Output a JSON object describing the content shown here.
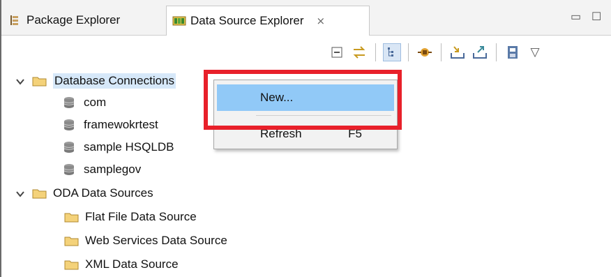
{
  "tabs": [
    {
      "label": "Package Explorer",
      "icon": "package-explorer-icon"
    },
    {
      "label": "Data Source Explorer",
      "icon": "data-source-explorer-icon",
      "close": "⨯"
    }
  ],
  "window_controls": {
    "minimize": "▭",
    "maximize": "☐"
  },
  "toolbar": {
    "buttons": [
      "collapse-all-icon",
      "link-with-editor-icon",
      "tree-layout-icon",
      "connect-icon",
      "import-icon",
      "export-icon",
      "save-icon",
      "view-menu-icon"
    ],
    "view_menu": "▽"
  },
  "tree": {
    "twisty_expanded": "∨",
    "database_connections": {
      "label": "Database Connections",
      "children": [
        "com",
        "framewokrtest",
        "sample HSQLDB",
        "samplegov"
      ]
    },
    "oda_data_sources": {
      "label": "ODA Data Sources",
      "children": [
        "Flat File Data Source",
        "Web Services Data Source",
        "XML Data Source"
      ]
    }
  },
  "context_menu": {
    "items": [
      {
        "label": "New...",
        "shortcut": ""
      },
      {
        "label": "Refresh",
        "shortcut": "F5"
      }
    ]
  },
  "colors": {
    "highlight": "#91c9f7",
    "callout": "#e8202a",
    "selection": "#d6e8f9"
  }
}
